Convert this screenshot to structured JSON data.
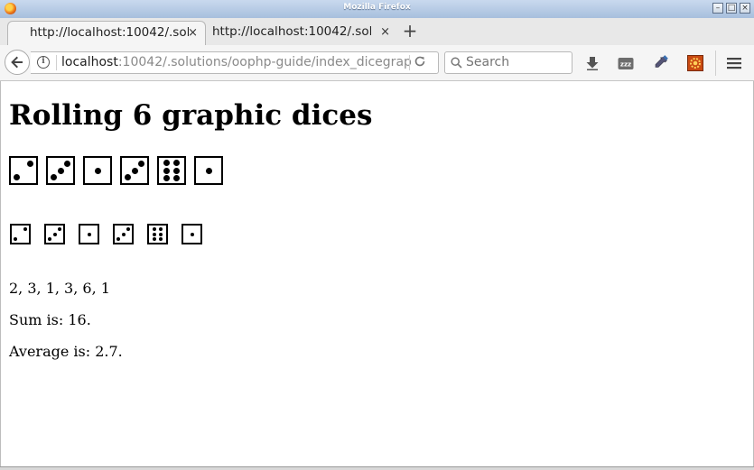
{
  "window": {
    "title": "Mozilla Firefox"
  },
  "tabs": [
    {
      "label": "http://localhost:10042/.solu",
      "close": "×"
    },
    {
      "label": "http://localhost:10042/.solu",
      "close": "×"
    }
  ],
  "new_tab_symbol": "+",
  "address": {
    "host": "localhost",
    "path": ":10042/.solutions/oophp-guide/index_dicegrap"
  },
  "search": {
    "placeholder": "Search"
  },
  "page": {
    "title": "Rolling 6 graphic dices",
    "dice": [
      2,
      3,
      1,
      3,
      6,
      1
    ],
    "values_line": "2, 3, 1, 3, 6, 1",
    "sum_line": "Sum is: 16.",
    "average_line": "Average is: 2.7."
  },
  "icons": {
    "back": "back-arrow-icon",
    "info": "info-icon",
    "reload": "reload-icon",
    "search": "search-icon",
    "download": "download-icon",
    "zzz": "sleep-tabs-icon",
    "eyedropper": "eyedropper-icon",
    "gear": "gear-icon",
    "menu": "hamburger-menu-icon"
  }
}
